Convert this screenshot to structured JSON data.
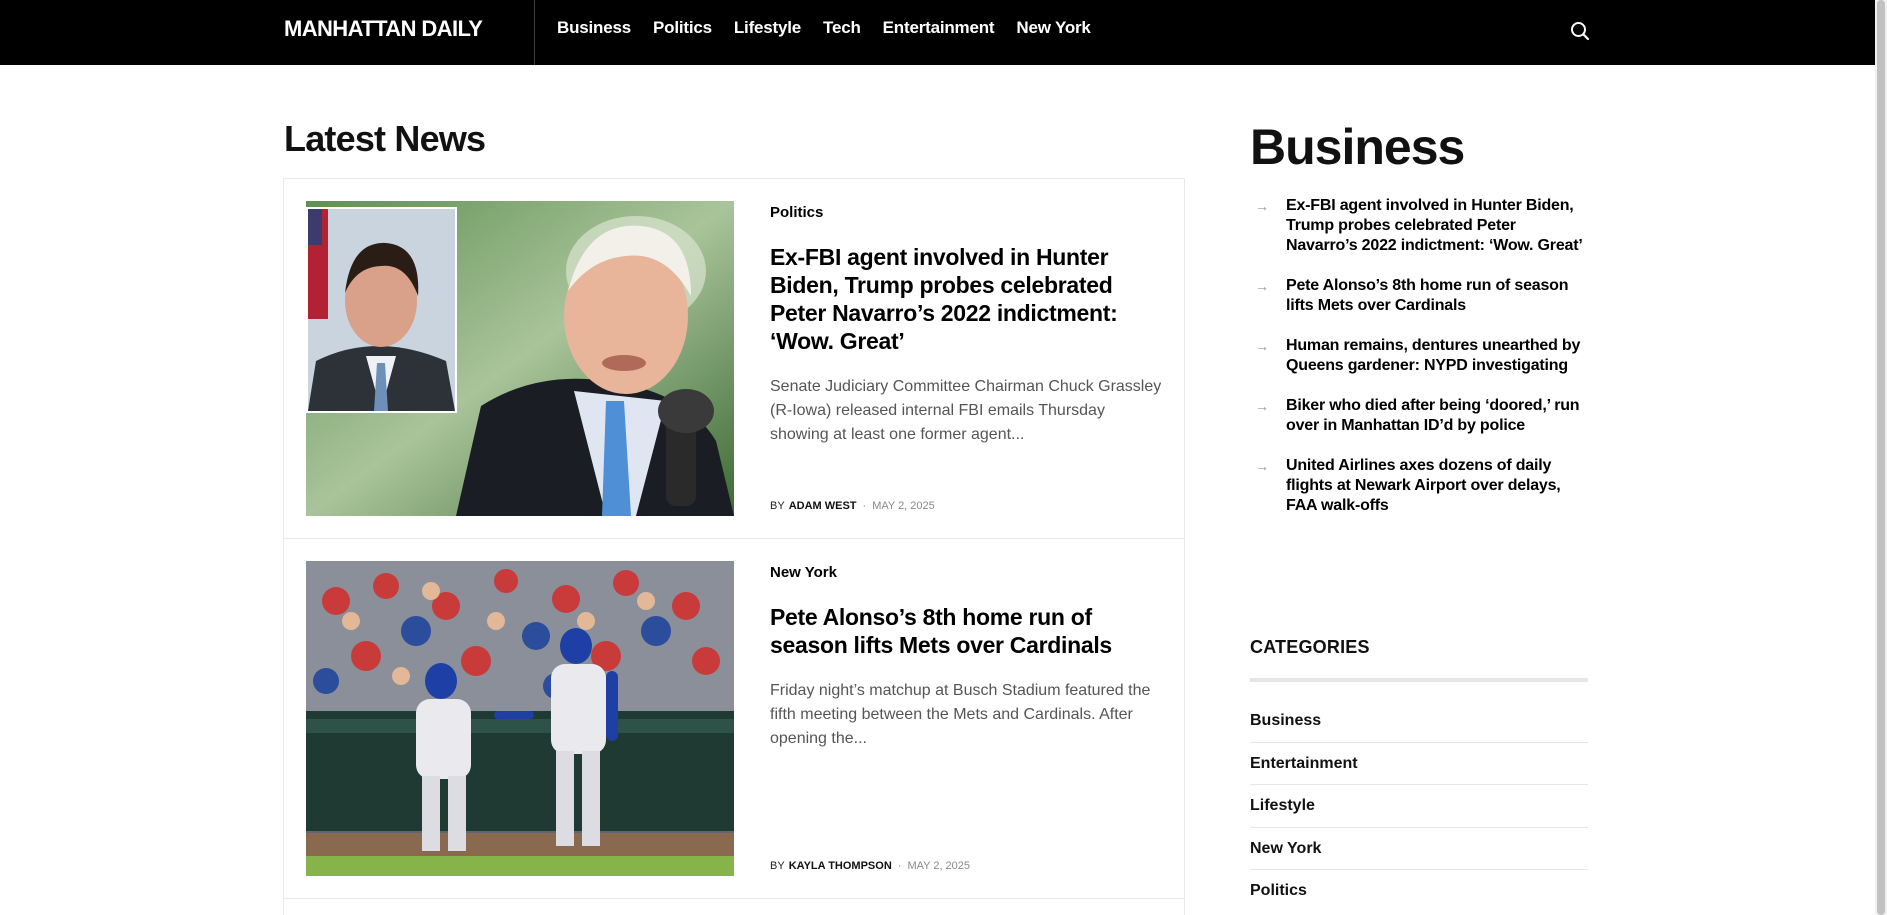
{
  "header": {
    "logo": "MANHATTAN DAILY",
    "nav": [
      "Business",
      "Politics",
      "Lifestyle",
      "Tech",
      "Entertainment",
      "New York"
    ],
    "search_icon": "search-icon"
  },
  "latest": {
    "title": "Latest News",
    "articles": [
      {
        "category": "Politics",
        "headline": "Ex-FBI agent involved in Hunter Biden, Trump probes celebrated Peter Navarro’s 2022 indictment: ‘Wow. Great’",
        "excerpt": "Senate Judiciary Committee Chairman Chuck Grassley (R-Iowa) released internal FBI emails Thursday showing at least one former agent...",
        "by": "BY",
        "author": "ADAM WEST",
        "sep": "·",
        "date": "MAY 2, 2025"
      },
      {
        "category": "New York",
        "headline": "Pete Alonso’s 8th home run of season lifts Mets over Cardinals",
        "excerpt": "Friday night’s matchup at Busch Stadium featured the fifth meeting between the Mets and Cardinals. After opening the...",
        "by": "BY",
        "author": "KAYLA THOMPSON",
        "sep": "·",
        "date": "MAY 2, 2025"
      }
    ]
  },
  "sidebar": {
    "business_title": "Business",
    "business_items": [
      "Ex-FBI agent involved in Hunter Biden, Trump probes celebrated Peter Navarro’s 2022 indictment: ‘Wow. Great’",
      "Pete Alonso’s 8th home run of season lifts Mets over Cardinals",
      "Human remains, dentures unearthed by Queens gardener: NYPD investigating",
      "Biker who died after being ‘doored,’ run over in Manhattan ID’d by police",
      "United Airlines axes dozens of daily flights at Newark Airport over delays, FAA walk-offs"
    ],
    "categories_title": "CATEGORIES",
    "categories": [
      "Business",
      "Entertainment",
      "Lifestyle",
      "New York",
      "Politics"
    ]
  }
}
